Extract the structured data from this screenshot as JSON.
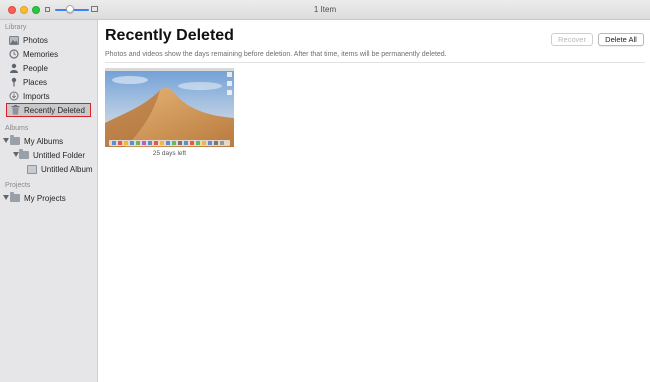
{
  "window": {
    "title": "1 Item"
  },
  "sidebar": {
    "library_header": "Library",
    "library_items": [
      {
        "label": "Photos",
        "icon": "photos-icon"
      },
      {
        "label": "Memories",
        "icon": "memories-icon"
      },
      {
        "label": "People",
        "icon": "people-icon"
      },
      {
        "label": "Places",
        "icon": "places-icon"
      },
      {
        "label": "Imports",
        "icon": "imports-icon"
      },
      {
        "label": "Recently Deleted",
        "icon": "trash-icon",
        "selected": true
      }
    ],
    "albums_header": "Albums",
    "albums_items": [
      {
        "label": "My Albums"
      },
      {
        "label": "Untitled Folder"
      },
      {
        "label": "Untitled Album"
      }
    ],
    "projects_header": "Projects",
    "projects_items": [
      {
        "label": "My Projects"
      }
    ]
  },
  "main": {
    "title": "Recently Deleted",
    "description": "Photos and videos show the days remaining before deletion. After that time, items will be permanently deleted.",
    "recover_button": "Recover",
    "delete_all_button": "Delete All",
    "items": [
      {
        "caption": "25 days left"
      }
    ]
  },
  "colors": {
    "selection_outline": "#d8222a",
    "sidebar_bg": "#e6e6e8",
    "zoom_accent": "#3b82f6"
  }
}
